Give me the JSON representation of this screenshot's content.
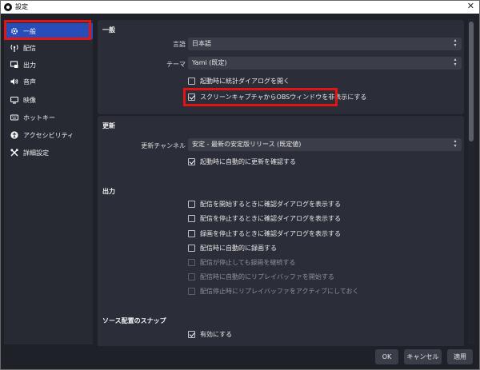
{
  "window": {
    "title": "設定",
    "close_glyph": "✕"
  },
  "sidebar": {
    "items": [
      {
        "label": "一般",
        "icon": "gear-icon"
      },
      {
        "label": "配信",
        "icon": "antenna-icon"
      },
      {
        "label": "出力",
        "icon": "output-icon"
      },
      {
        "label": "音声",
        "icon": "speaker-icon"
      },
      {
        "label": "映像",
        "icon": "monitor-icon"
      },
      {
        "label": "ホットキー",
        "icon": "keyboard-icon"
      },
      {
        "label": "アクセシビリティ",
        "icon": "accessibility-icon"
      },
      {
        "label": "詳細設定",
        "icon": "tools-icon"
      }
    ]
  },
  "general": {
    "title": "一般",
    "language_label": "言語",
    "language_value": "日本語",
    "theme_label": "テーマ",
    "theme_value": "Yami (既定)",
    "check_stats": "起動時に統計ダイアログを開く",
    "check_hide_obs": "スクリーンキャプチャからOBSウィンドウを非表示にする"
  },
  "update": {
    "title": "更新",
    "channel_label": "更新チャンネル",
    "channel_value": "安定 - 最新の安定版リリース (既定値)",
    "check_auto": "起動時に自動的に更新を確認する"
  },
  "output": {
    "title": "出力",
    "checks": [
      "配信を開始するときに確認ダイアログを表示する",
      "配信を停止するときに確認ダイアログを表示する",
      "録画を停止するときに確認ダイアログを表示する",
      "配信時に自動的に録画する",
      "配信が停止しても録画を継続する",
      "配信時に自動的にリプレイバッファを開始する",
      "配信停止時にリプレイバッファをアクティブにしておく"
    ]
  },
  "snap": {
    "title": "ソース配置のスナップ",
    "check_enable": "有効にする"
  },
  "buttons": {
    "ok": "OK",
    "cancel": "キャンセル",
    "apply": "適用"
  }
}
